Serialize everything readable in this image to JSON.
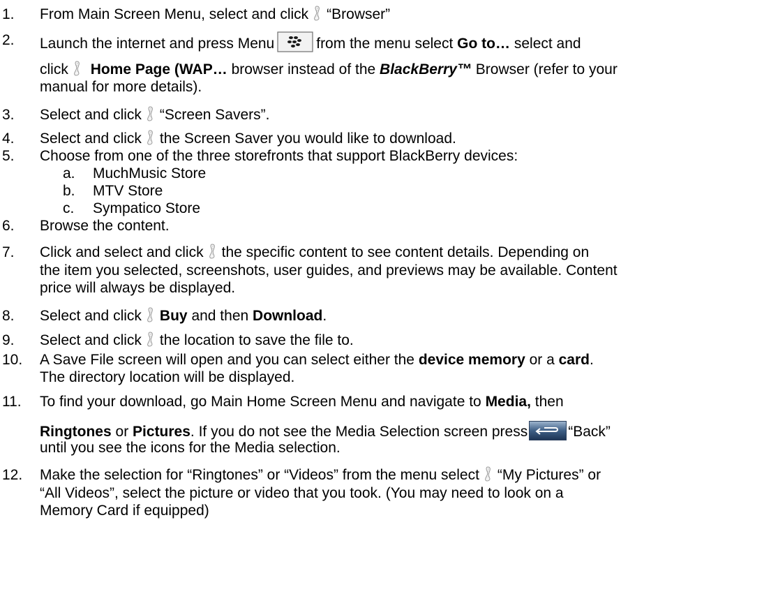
{
  "steps": {
    "s1": {
      "num": "1.",
      "a": "From Main Screen Menu, select and click",
      "b": "“Browser”"
    },
    "s2": {
      "num": "2.",
      "a": "Launch the internet and press Menu",
      "b": "from the menu select",
      "c": "Go to…",
      "d": "select and",
      "e": "click",
      "f": "Home Page (WAP…",
      "g": "browser instead of the",
      "h": "BlackBerry™",
      "i": "Browser (refer to your",
      "j": "manual for more details)."
    },
    "s3": {
      "num": "3.",
      "a": "Select and click",
      "b": "“Screen Savers”."
    },
    "s4": {
      "num": "4.",
      "a": "Select and click",
      "b": "the Screen Saver you would like to download."
    },
    "s5": {
      "num": "5.",
      "a": "Choose from one of the three storefronts that support BlackBerry devices:",
      "subs": [
        {
          "l": "a.",
          "t": "MuchMusic Store"
        },
        {
          "l": "b.",
          "t": "MTV Store"
        },
        {
          "l": "c.",
          "t": "Sympatico Store"
        }
      ]
    },
    "s6": {
      "num": "6.",
      "a": "Browse the content."
    },
    "s7": {
      "num": "7.",
      "a": "Click and select and click",
      "b": "the specific content to see content details. Depending on",
      "c": "the item you selected, screenshots, user guides, and previews may be available. Content",
      "d": "price will always be displayed."
    },
    "s8": {
      "num": "8.",
      "a": "Select and click",
      "b": "Buy",
      "c": "and then",
      "d": "Download",
      "e": "."
    },
    "s9": {
      "num": "9.",
      "a": "Select and click",
      "b": "the location to save the file to."
    },
    "s10": {
      "num": "10.",
      "a": "A Save File screen will open and you can select either the",
      "b": "device memory",
      "c": "or a",
      "d": "card",
      "e": ".",
      "f": "The directory location will be displayed."
    },
    "s11": {
      "num": "11.",
      "a": "To find your download, go Main Home Screen Menu and navigate to",
      "b": "Media,",
      "c": "then",
      "d": "Ringtones",
      "e": "or",
      "f": "Pictures",
      "g": ". If you do not see the Media Selection screen press",
      "h": "“Back”",
      "i": "until you see the icons for the Media selection."
    },
    "s12": {
      "num": "12.",
      "a": "Make the selection for “Ringtones” or “Videos” from the menu select",
      "b": "“My Pictures” or",
      "c": "“All Videos”, select the picture or video that you took. (You may need to look on a",
      "d": "Memory Card if equipped)"
    }
  },
  "icons": {
    "wheel": "trackwheel-click-icon",
    "menu": "blackberry-menu-key-icon",
    "back": "back-key-icon"
  }
}
